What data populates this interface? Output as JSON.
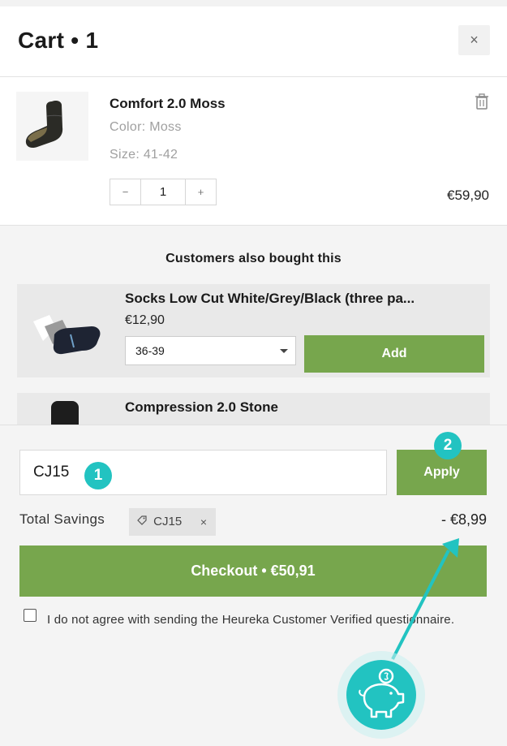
{
  "header": {
    "title": "Cart • 1",
    "close": "×"
  },
  "cart_item": {
    "name": "Comfort 2.0 Moss",
    "color": "Color: Moss",
    "size": "Size: 41-42",
    "qty_minus": "−",
    "qty_value": "1",
    "qty_plus": "+",
    "price": "€59,90",
    "thumb_icon": "sock-icon",
    "delete_icon": "trash-icon"
  },
  "recommendations": {
    "title": "Customers also bought this",
    "items": [
      {
        "name": "Socks Low Cut White/Grey/Black (three pa...",
        "price": "€12,90",
        "size_selected": "36-39",
        "add_label": "Add"
      },
      {
        "name": "Compression 2.0 Stone"
      }
    ]
  },
  "coupon": {
    "value": "CJ15",
    "apply_label": "Apply"
  },
  "savings": {
    "label": "Total Savings",
    "code": "CJ15",
    "remove": "×",
    "value": "- €8,99"
  },
  "checkout": {
    "label": "Checkout • €50,91"
  },
  "consent": {
    "text": "I do not agree with sending the Heureka Customer Verified questionnaire."
  },
  "annotations": {
    "marker1": "1",
    "marker2": "2",
    "accent_color": "#22c3c1",
    "brand_green": "#77a64d",
    "badge_icon": "piggy-bank-icon"
  }
}
